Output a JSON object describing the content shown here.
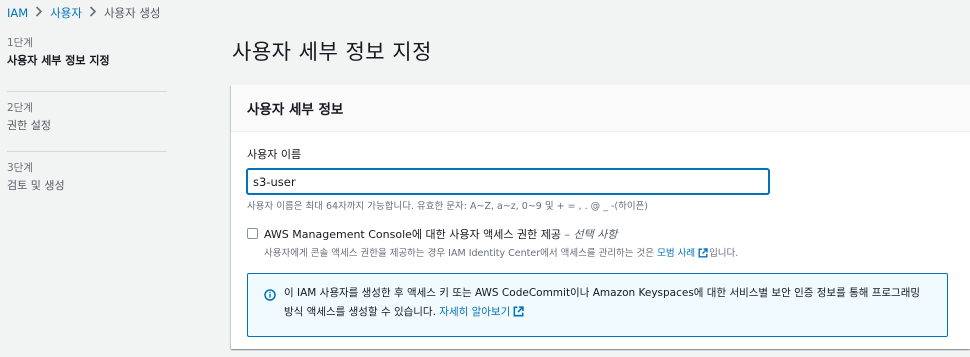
{
  "breadcrumb": {
    "items": [
      "IAM",
      "사용자",
      "사용자 생성"
    ]
  },
  "steps": [
    {
      "num": "1단계",
      "label": "사용자 세부 정보 지정"
    },
    {
      "num": "2단계",
      "label": "권한 설정"
    },
    {
      "num": "3단계",
      "label": "검토 및 생성"
    }
  ],
  "page_title": "사용자 세부 정보 지정",
  "panel": {
    "title": "사용자 세부 정보",
    "username": {
      "label": "사용자 이름",
      "value": "s3-user",
      "constraint": "사용자 이름은 최대 64자까지 가능합니다. 유효한 문자: A~Z, a~z, 0~9 및 + = , . @ _ -(하이픈)"
    },
    "console_access": {
      "label": "AWS Management Console에 대한 사용자 액세스 권한 제공",
      "optional": "– 선택 사항",
      "description_prefix": "사용자에게 콘솔 액세스 권한을 제공하는 경우 IAM Identity Center에서 액세스를 관리하는 것은",
      "link": "모범 사례",
      "description_suffix": "입니다.",
      "checked": false
    },
    "info": {
      "text": "이 IAM 사용자를 생성한 후 액세스 키 또는 AWS CodeCommit이나 Amazon Keyspaces에 대한 서비스별 보안 인증 정보를 통해 프로그래밍 방식 액세스를 생성할 수 있습니다.",
      "link": "자세히 알아보기"
    }
  },
  "colors": {
    "link": "#0073bb",
    "info_bg": "#f1faff",
    "page_bg": "#f2f3f3"
  },
  "icons": [
    "chevron-right-icon",
    "external-link-icon",
    "info-icon"
  ]
}
